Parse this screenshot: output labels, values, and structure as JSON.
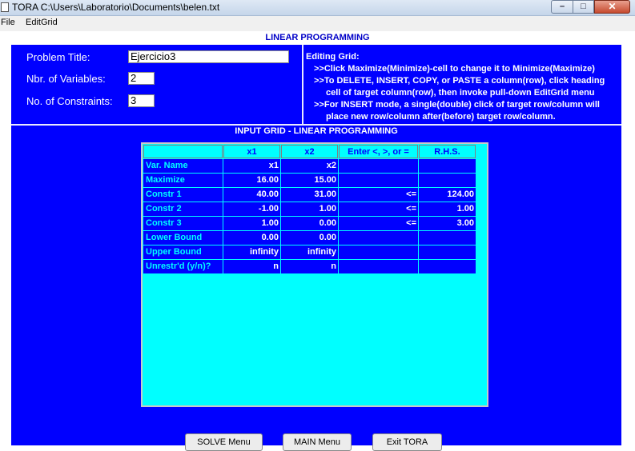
{
  "window": {
    "title": "TORA  C:\\Users\\Laboratorio\\Documents\\belen.txt",
    "minimize_glyph": "–",
    "maximize_glyph": "□",
    "close_glyph": "✕"
  },
  "menu": {
    "file": "File",
    "editgrid": "EditGrid"
  },
  "heading": "LINEAR PROGRAMMING",
  "problem": {
    "title_label": "Problem Title:",
    "title_value": "Ejercicio3",
    "vars_label": "Nbr. of Variables:",
    "vars_value": "2",
    "constraints_label": "No. of Constraints:",
    "constraints_value": "3"
  },
  "editing_help": {
    "title": "Editing Grid:",
    "lines": [
      ">>Click Maximize(Minimize)-cell to change it to Minimize(Maximize)",
      ">>To DELETE, INSERT, COPY, or PASTE a column(row), click heading",
      "cell of target column(row), then invoke pull-down EditGrid menu",
      ">>For INSERT mode, a single(double) click of target row/column will",
      "place new row/column after(before) target row/column."
    ]
  },
  "grid": {
    "title": "INPUT GRID - LINEAR PROGRAMMING",
    "headers": [
      "",
      "x1",
      "x2",
      "Enter <, >, or =",
      "R.H.S."
    ],
    "rows": [
      {
        "label": "Var. Name",
        "x1": "x1",
        "x2": "x2",
        "op": "",
        "rhs": ""
      },
      {
        "label": "Maximize",
        "x1": "16.00",
        "x2": "15.00",
        "op": "",
        "rhs": ""
      },
      {
        "label": "Constr 1",
        "x1": "40.00",
        "x2": "31.00",
        "op": "<=",
        "rhs": "124.00"
      },
      {
        "label": "Constr 2",
        "x1": "-1.00",
        "x2": "1.00",
        "op": "<=",
        "rhs": "1.00"
      },
      {
        "label": "Constr 3",
        "x1": "1.00",
        "x2": "0.00",
        "op": "<=",
        "rhs": "3.00"
      },
      {
        "label": "Lower Bound",
        "x1": "0.00",
        "x2": "0.00",
        "op": "",
        "rhs": ""
      },
      {
        "label": "Upper Bound",
        "x1": "infinity",
        "x2": "infinity",
        "op": "",
        "rhs": ""
      },
      {
        "label": "Unrestr'd (y/n)?",
        "x1": "n",
        "x2": "n",
        "op": "",
        "rhs": ""
      }
    ]
  },
  "buttons": {
    "solve": "SOLVE Menu",
    "main": "MAIN Menu",
    "exit": "Exit TORA"
  }
}
